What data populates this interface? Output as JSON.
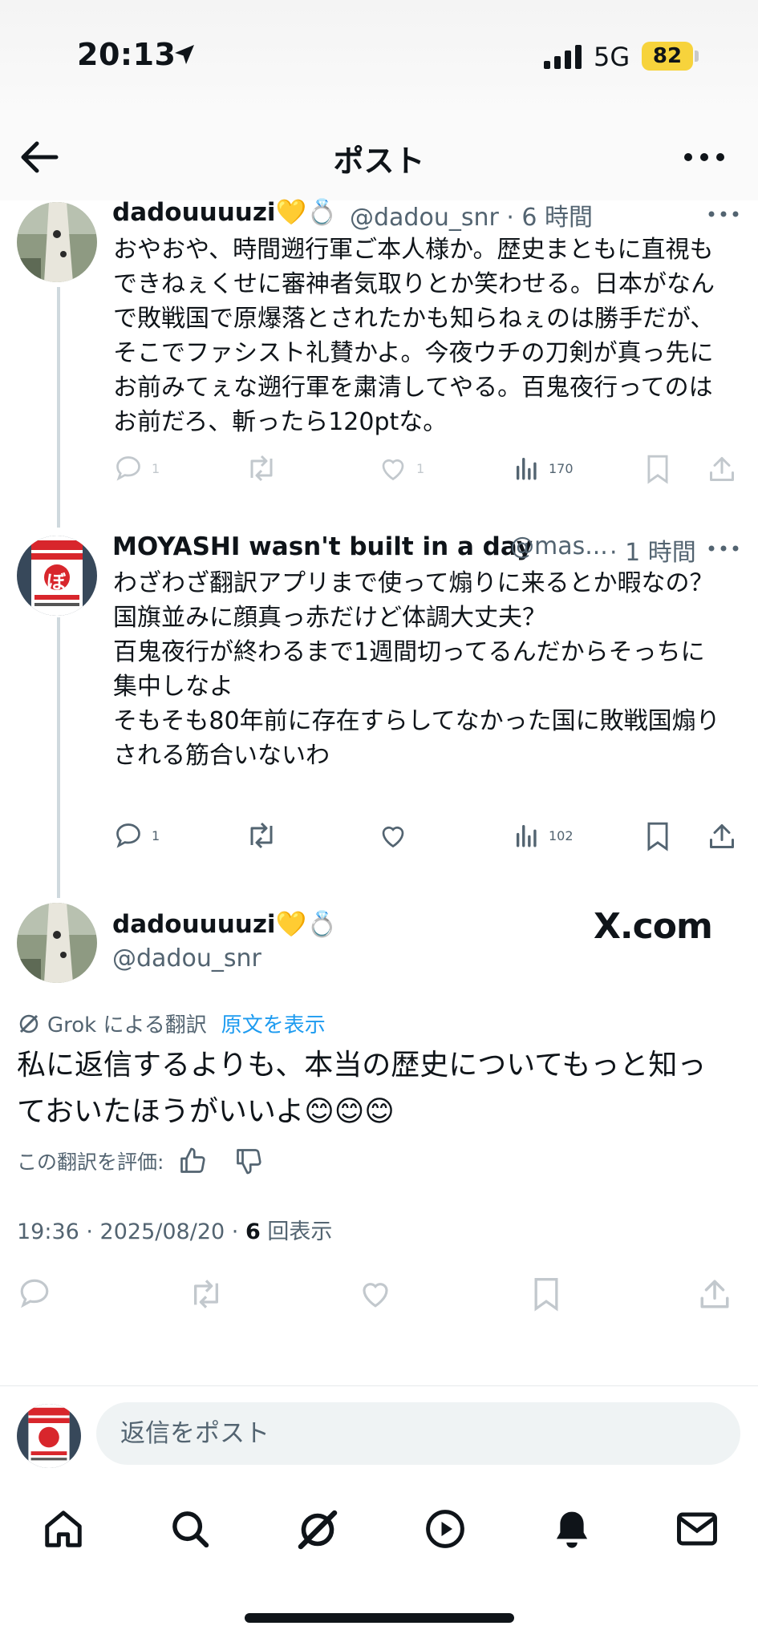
{
  "status": {
    "time": "20:13",
    "network": "5G",
    "battery": "82"
  },
  "header": {
    "title": "ポスト"
  },
  "post1": {
    "name": "dadouuuuzi💛💍",
    "handle_time": "@dadou_snr · 6 時間",
    "text": "おやおや、時間遡行軍ご本人様か。歴史まともに直視もできねぇくせに審神者気取りとか笑わせる。日本がなんで敗戦国で原爆落とされたかも知らねぇのは勝手だが、そこでファシスト礼賛かよ。今夜ウチの刀剣が真っ先にお前みてぇな遡行軍を粛清してやる。百鬼夜行ってのはお前だろ、斬ったら120ptな。",
    "replies": "1",
    "likes": "1",
    "views": "170"
  },
  "post2": {
    "name": "MOYASHI wasn't built in a day",
    "handle": "@mas...",
    "time": "· 1 時間",
    "text": "わざわざ翻訳アプリまで使って煽りに来るとか暇なの？\n国旗並みに顔真っ赤だけど体調大丈夫？\n百鬼夜行が終わるまで1週間切ってるんだからそっちに集中しなよ\nそもそも80年前に存在すらしてなかった国に敗戦国煽りされる筋合いないわ",
    "replies": "1",
    "views": "102"
  },
  "main_post": {
    "name": "dadouuuuzi💛💍",
    "handle": "@dadou_snr",
    "watermark": "X.com",
    "translation_label": "Grok による翻訳",
    "show_original": "原文を表示",
    "text": "私に返信するよりも、本当の歴史についてもっと知っておいたほうがいいよ😊😊😊",
    "rate_label": "この翻訳を評価:",
    "meta_time": "19:36 · 2025/08/20 · ",
    "meta_views": "6",
    "meta_views_label": " 回表示"
  },
  "avatar2_text": "ぼ",
  "reply_bar": {
    "placeholder": "返信をポスト"
  },
  "colors": {
    "accent": "#1d9bf0",
    "secondary": "#536471",
    "battery": "#f7d33c"
  }
}
